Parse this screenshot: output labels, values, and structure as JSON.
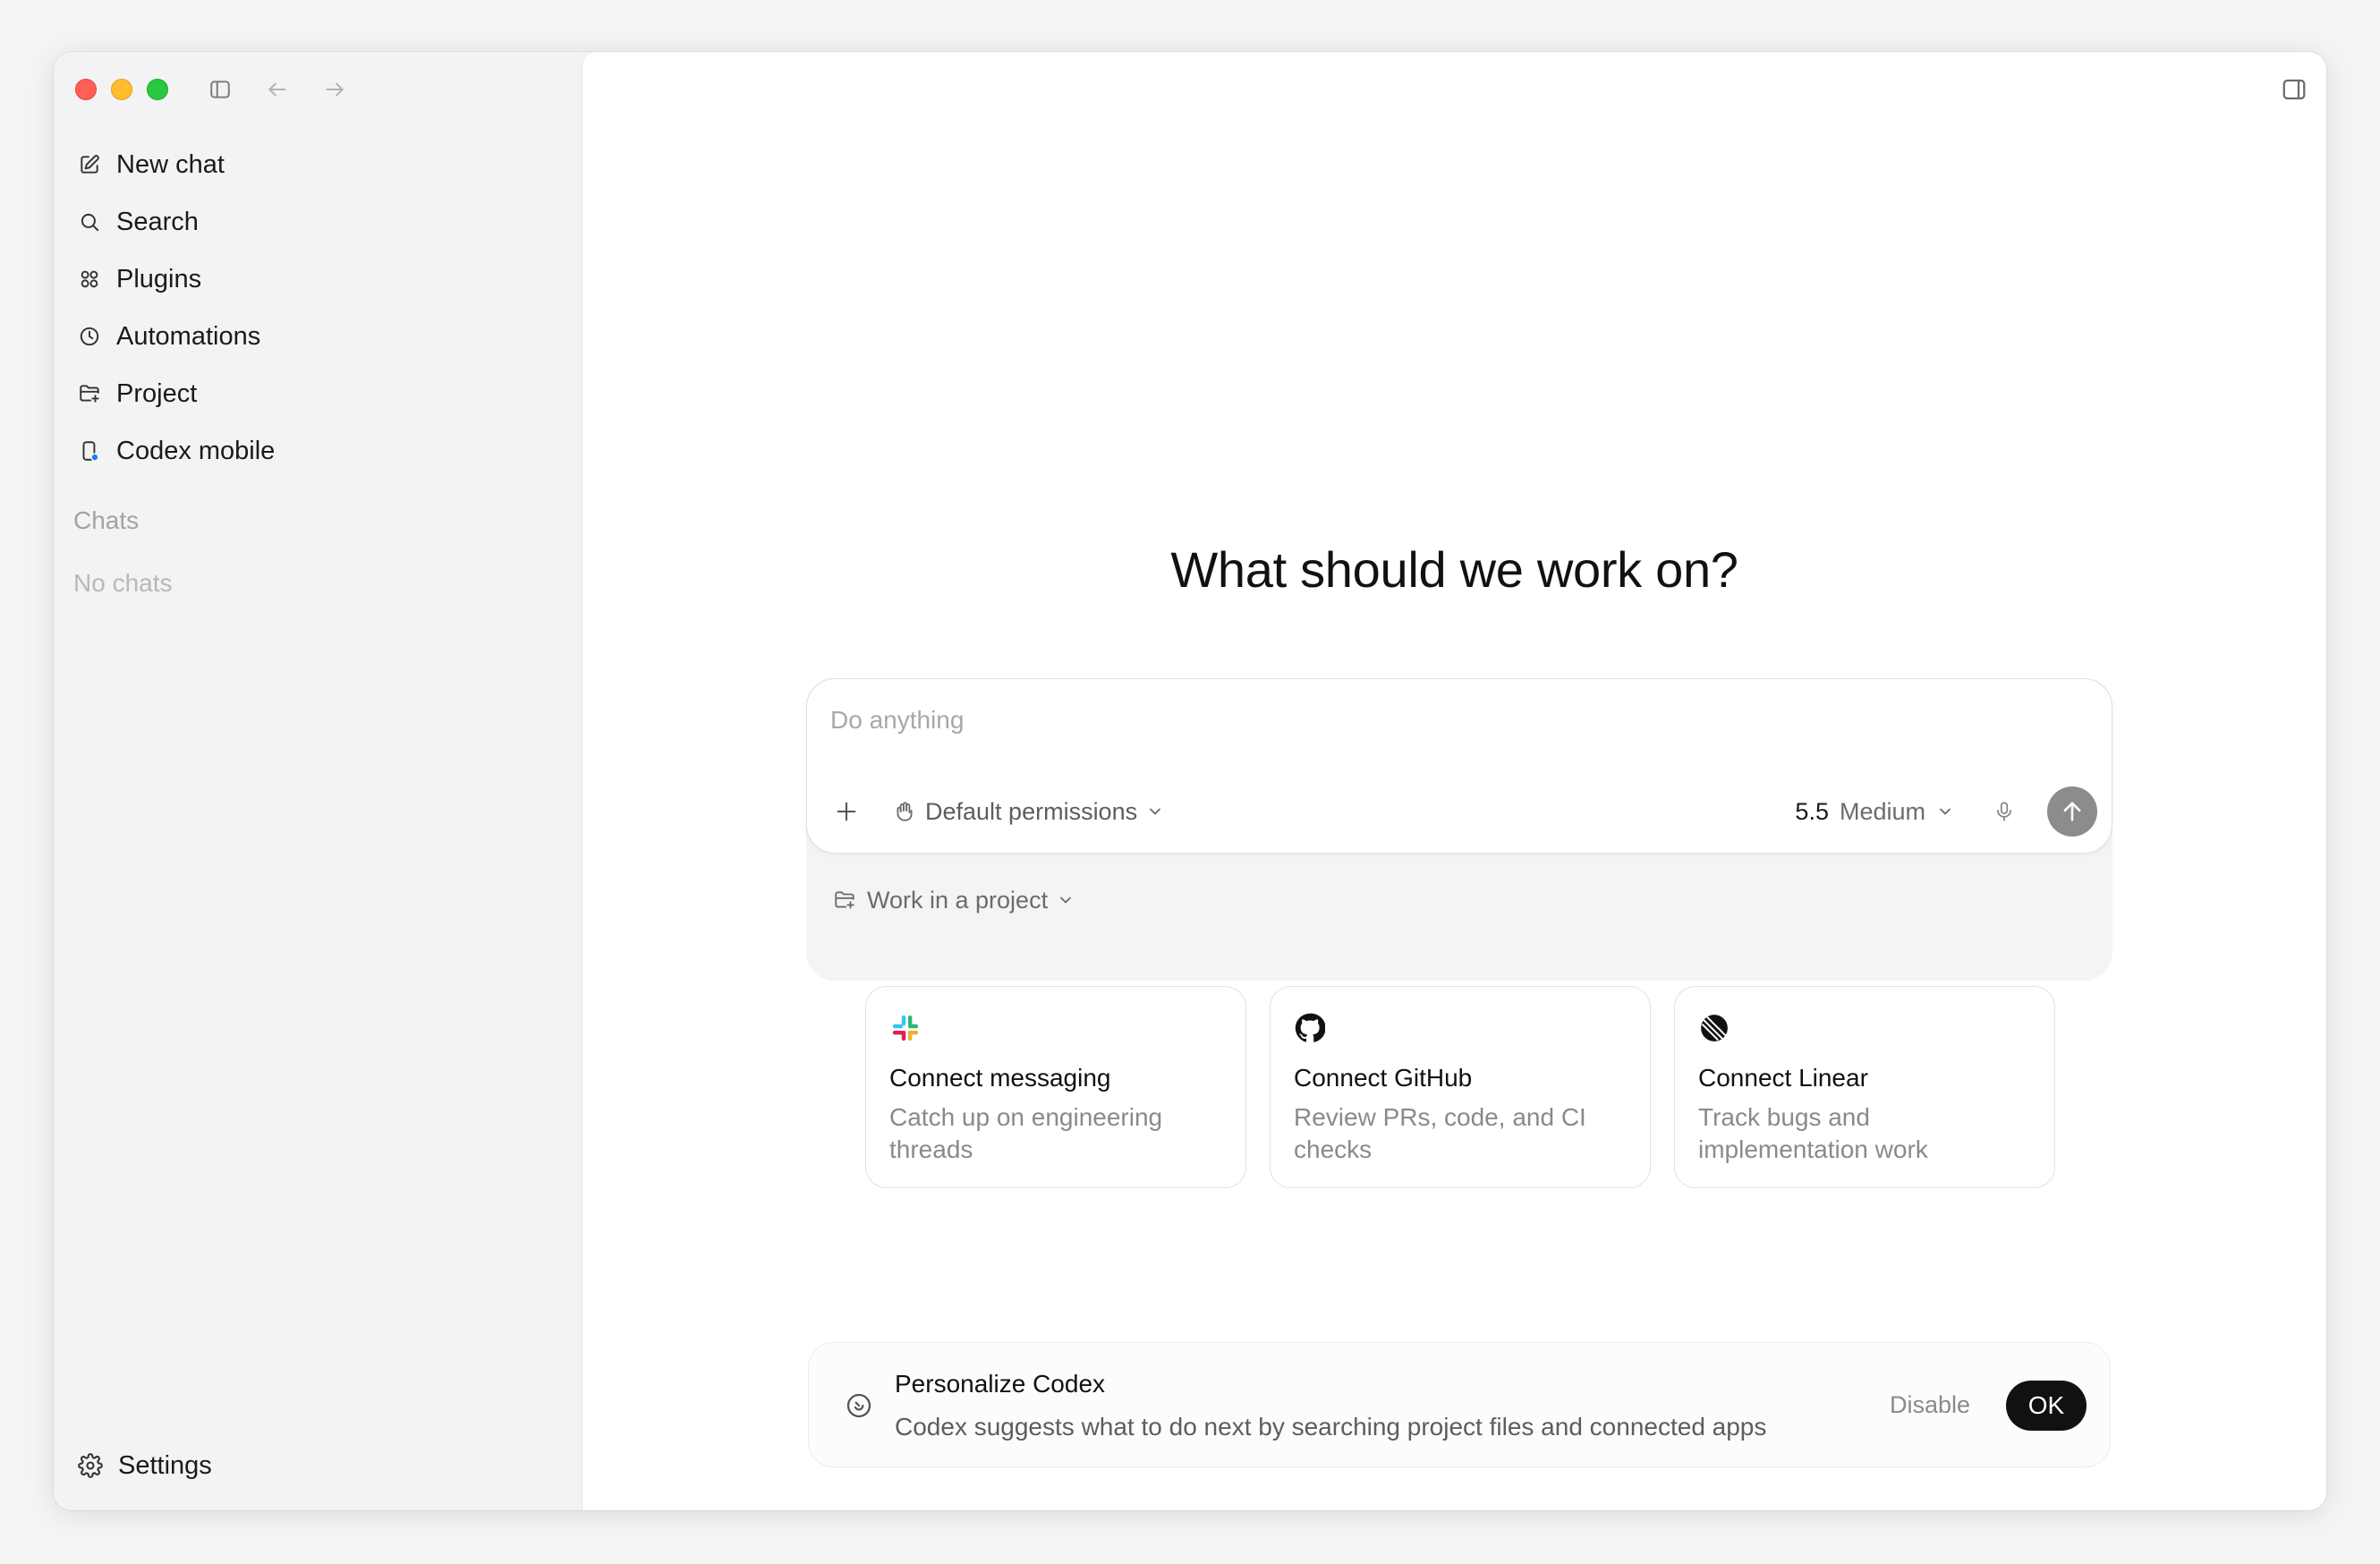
{
  "sidebar": {
    "nav": [
      {
        "label": "New chat",
        "icon": "edit-icon"
      },
      {
        "label": "Search",
        "icon": "search-icon"
      },
      {
        "label": "Plugins",
        "icon": "grid-icon"
      },
      {
        "label": "Automations",
        "icon": "clock-icon"
      },
      {
        "label": "Project",
        "icon": "folder-plus-icon"
      },
      {
        "label": "Codex mobile",
        "icon": "phone-icon"
      }
    ],
    "section_title": "Chats",
    "empty_text": "No chats",
    "settings_label": "Settings"
  },
  "main": {
    "heading": "What should we work on?",
    "composer": {
      "placeholder": "Do anything",
      "permissions_label": "Default permissions",
      "model_version": "5.5",
      "model_level": "Medium",
      "project_label": "Work in a project"
    },
    "cards": [
      {
        "title": "Connect messaging",
        "desc": "Catch up on engineering threads",
        "icon": "slack-icon"
      },
      {
        "title": "Connect GitHub",
        "desc": "Review PRs, code, and CI checks",
        "icon": "github-icon"
      },
      {
        "title": "Connect Linear",
        "desc": "Track bugs and implementation work",
        "icon": "linear-icon"
      }
    ],
    "banner": {
      "title": "Personalize Codex",
      "desc": "Codex suggests what to do next by searching project files and connected apps",
      "disable_label": "Disable",
      "ok_label": "OK"
    }
  },
  "colors": {
    "send_button": "#8c8c8c",
    "ok_button": "#111111",
    "mobile_dot": "#1d7cf2"
  }
}
